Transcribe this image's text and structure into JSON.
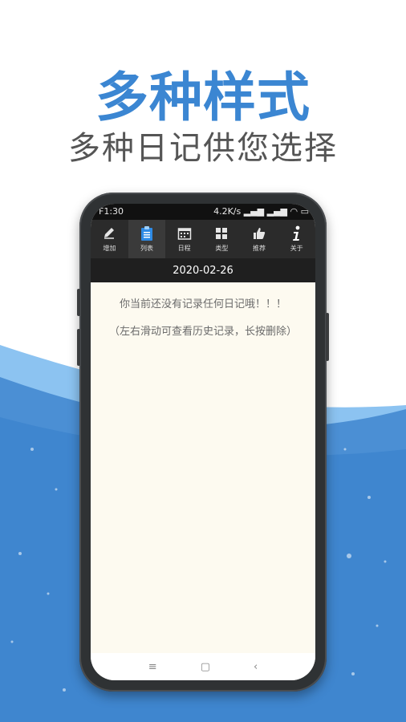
{
  "headline": "多种样式",
  "subline": "多种日记供您选择",
  "status": {
    "time": "F1:30",
    "net_speed": "4.2K/s"
  },
  "toolbar": {
    "tabs": [
      {
        "label": "增加",
        "icon": "pencil-icon"
      },
      {
        "label": "列表",
        "icon": "clipboard-icon"
      },
      {
        "label": "日程",
        "icon": "calendar-icon"
      },
      {
        "label": "类型",
        "icon": "grid-icon"
      },
      {
        "label": "推荐",
        "icon": "thumbs-up-icon"
      },
      {
        "label": "关于",
        "icon": "info-icon"
      }
    ],
    "active_tab": "列表"
  },
  "date": "2020-02-26",
  "empty_message": "你当前还没有记录任何日记哦！！！",
  "hint_message": "（左右滑动可查看历史记录，长按删除）",
  "colors": {
    "accent_blue": "#3b86d2",
    "active_tab_icon": "#2e8be6",
    "screen_bg": "#fdfaf0"
  }
}
